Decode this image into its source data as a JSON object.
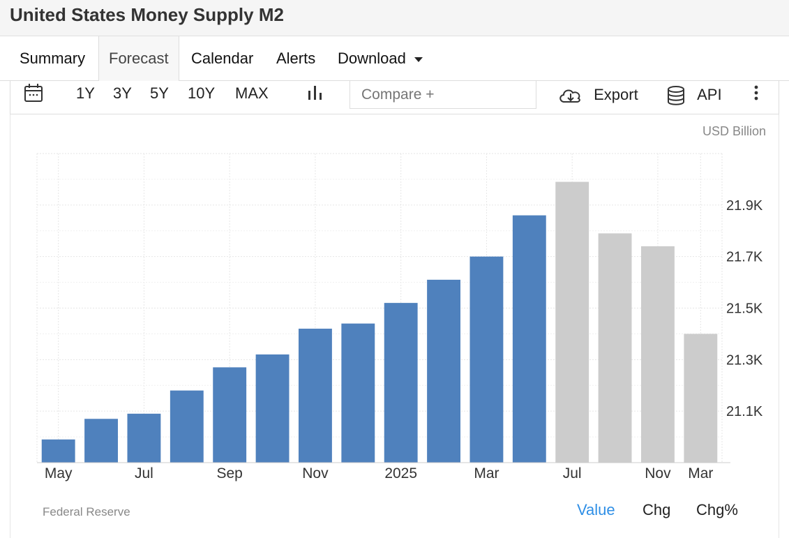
{
  "header": {
    "title": "United States Money Supply M2"
  },
  "tabs": [
    {
      "label": "Summary",
      "active": false
    },
    {
      "label": "Forecast",
      "active": true
    },
    {
      "label": "Calendar",
      "active": false
    },
    {
      "label": "Alerts",
      "active": false
    },
    {
      "label": "Download",
      "active": false
    }
  ],
  "toolbar": {
    "ranges": [
      "1Y",
      "3Y",
      "5Y",
      "10Y",
      "MAX"
    ],
    "compare_placeholder": "Compare +",
    "export_label": "Export",
    "api_label": "API"
  },
  "unit_label": "USD Billion",
  "source": "Federal Reserve",
  "value_tabs": [
    {
      "label": "Value",
      "active": true
    },
    {
      "label": "Chg",
      "active": false
    },
    {
      "label": "Chg%",
      "active": false
    }
  ],
  "colors": {
    "actual": "#4f81bd",
    "forecast": "#cccccc",
    "accent": "#2f8fe6"
  },
  "chart_data": {
    "type": "bar",
    "series": [
      {
        "values": [
          20.99,
          21.07,
          21.09,
          21.18,
          21.27,
          21.32,
          21.42,
          21.44,
          21.52,
          21.61,
          21.7,
          21.86
        ],
        "kind": "actual"
      },
      {
        "values": [
          21.99,
          21.79,
          21.74,
          21.4
        ],
        "kind": "forecast"
      }
    ],
    "x_tick_labels": [
      {
        "index": 0,
        "label": "May"
      },
      {
        "index": 2,
        "label": "Jul"
      },
      {
        "index": 4,
        "label": "Sep"
      },
      {
        "index": 6,
        "label": "Nov"
      },
      {
        "index": 8,
        "label": "2025"
      },
      {
        "index": 10,
        "label": "Mar"
      },
      {
        "index": 12,
        "label": "Jul"
      },
      {
        "index": 14,
        "label": "Nov"
      },
      {
        "index": 15,
        "label": "Mar"
      }
    ],
    "y_ticks": [
      {
        "value": 21.1,
        "label": "21.1K"
      },
      {
        "value": 21.3,
        "label": "21.3K"
      },
      {
        "value": 21.5,
        "label": "21.5K"
      },
      {
        "value": 21.7,
        "label": "21.7K"
      },
      {
        "value": 21.9,
        "label": "21.9K"
      }
    ],
    "ylim": [
      20.9,
      22.1
    ],
    "grid": true
  }
}
